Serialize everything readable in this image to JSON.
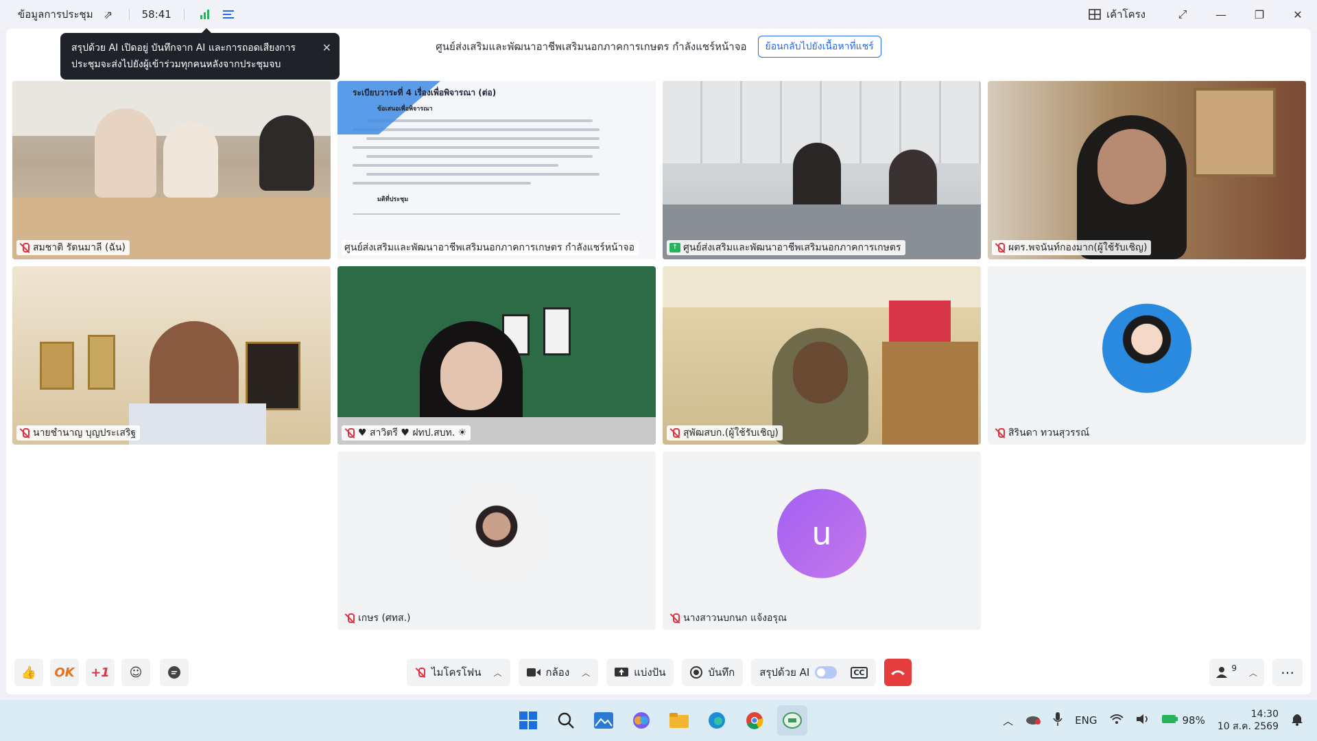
{
  "topbar": {
    "meeting_info": "ข้อมูลการประชุม",
    "timer": "58:41",
    "layout_label": "เค้าโครง"
  },
  "share_notice": {
    "text": "ศูนย์ส่งเสริมและพัฒนาอาชีพเสริมนอกภาคการเกษตร กำลังแชร์หน้าจอ",
    "back_button": "ย้อนกลับไปยังเนื้อหาที่แชร์"
  },
  "ai_tooltip": {
    "text": "สรุปด้วย AI เปิดอยู่ บันทึกจาก AI และการถอดเสียงการประชุมจะส่งไปยังผู้เข้าร่วมทุกคนหลังจากประชุมจบ"
  },
  "tiles": [
    {
      "name": "สมชาติ รัตนมาลี (ฉัน)"
    },
    {
      "name": "ศูนย์ส่งเสริมและพัฒนาอาชีพเสริมนอกภาคการเกษตร กำลังแชร์หน้าจอ"
    },
    {
      "name": "ศูนย์ส่งเสริมและพัฒนาอาชีพเสริมนอกภาคการเกษตร"
    },
    {
      "name": "ผตร.พจนันท์กองมาก(ผู้ใช้รับเชิญ)"
    },
    {
      "name": "นายชำนาญ บุญประเสริฐ"
    },
    {
      "name": "♥ สาวิตรี ♥ ฝทป.สบท. ☀"
    },
    {
      "name": "สุพัฒสบก.(ผู้ใช้รับเชิญ)"
    },
    {
      "name": "สิรินดา ทวนสุวรรณ์"
    },
    {
      "name": "เกษร (ศทส.)"
    },
    {
      "name": "นางสาวนบกนก แจ้งอรุณ",
      "avatar_letter": "u"
    }
  ],
  "slide": {
    "title": "ระเบียบวาระที่ 4 เรื่องเพื่อพิจารณา (ต่อ)",
    "subheading": "ข้อเสนอเพื่อพิจารณา",
    "footer_label": "มติที่ประชุม"
  },
  "reactions": [
    "👍",
    "OK",
    "+1",
    "☺"
  ],
  "toolbar": {
    "mic": "ไมโครโฟน",
    "camera": "กล้อง",
    "share": "แบ่งปัน",
    "record": "บันทึก",
    "ai_summary": "สรุปด้วย AI",
    "participants_count": "9"
  },
  "taskbar": {
    "lang": "ENG",
    "battery": "98%",
    "time": "14:30",
    "date": "10 ส.ค. 2569"
  },
  "colors": {
    "accent": "#2468f2",
    "end_call": "#e43d3d",
    "mic_off": "#e0313d"
  }
}
